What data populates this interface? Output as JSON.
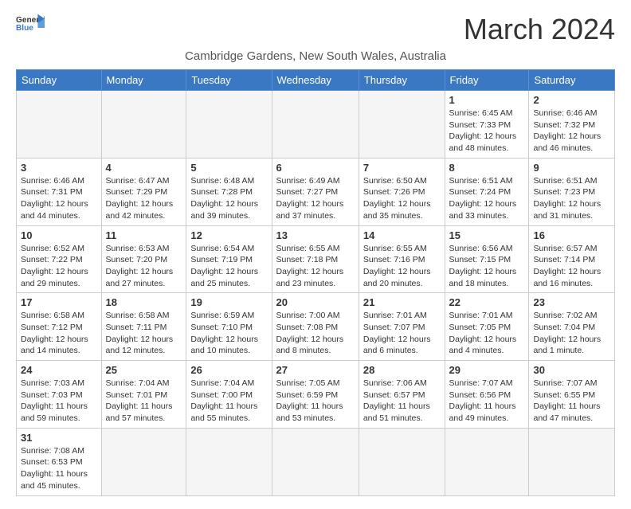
{
  "logo": {
    "general": "General",
    "blue": "Blue"
  },
  "title": "March 2024",
  "location": "Cambridge Gardens, New South Wales, Australia",
  "days_header": [
    "Sunday",
    "Monday",
    "Tuesday",
    "Wednesday",
    "Thursday",
    "Friday",
    "Saturday"
  ],
  "weeks": [
    [
      {
        "day": "",
        "info": ""
      },
      {
        "day": "",
        "info": ""
      },
      {
        "day": "",
        "info": ""
      },
      {
        "day": "",
        "info": ""
      },
      {
        "day": "",
        "info": ""
      },
      {
        "day": "1",
        "info": "Sunrise: 6:45 AM\nSunset: 7:33 PM\nDaylight: 12 hours and 48 minutes."
      },
      {
        "day": "2",
        "info": "Sunrise: 6:46 AM\nSunset: 7:32 PM\nDaylight: 12 hours and 46 minutes."
      }
    ],
    [
      {
        "day": "3",
        "info": "Sunrise: 6:46 AM\nSunset: 7:31 PM\nDaylight: 12 hours and 44 minutes."
      },
      {
        "day": "4",
        "info": "Sunrise: 6:47 AM\nSunset: 7:29 PM\nDaylight: 12 hours and 42 minutes."
      },
      {
        "day": "5",
        "info": "Sunrise: 6:48 AM\nSunset: 7:28 PM\nDaylight: 12 hours and 39 minutes."
      },
      {
        "day": "6",
        "info": "Sunrise: 6:49 AM\nSunset: 7:27 PM\nDaylight: 12 hours and 37 minutes."
      },
      {
        "day": "7",
        "info": "Sunrise: 6:50 AM\nSunset: 7:26 PM\nDaylight: 12 hours and 35 minutes."
      },
      {
        "day": "8",
        "info": "Sunrise: 6:51 AM\nSunset: 7:24 PM\nDaylight: 12 hours and 33 minutes."
      },
      {
        "day": "9",
        "info": "Sunrise: 6:51 AM\nSunset: 7:23 PM\nDaylight: 12 hours and 31 minutes."
      }
    ],
    [
      {
        "day": "10",
        "info": "Sunrise: 6:52 AM\nSunset: 7:22 PM\nDaylight: 12 hours and 29 minutes."
      },
      {
        "day": "11",
        "info": "Sunrise: 6:53 AM\nSunset: 7:20 PM\nDaylight: 12 hours and 27 minutes."
      },
      {
        "day": "12",
        "info": "Sunrise: 6:54 AM\nSunset: 7:19 PM\nDaylight: 12 hours and 25 minutes."
      },
      {
        "day": "13",
        "info": "Sunrise: 6:55 AM\nSunset: 7:18 PM\nDaylight: 12 hours and 23 minutes."
      },
      {
        "day": "14",
        "info": "Sunrise: 6:55 AM\nSunset: 7:16 PM\nDaylight: 12 hours and 20 minutes."
      },
      {
        "day": "15",
        "info": "Sunrise: 6:56 AM\nSunset: 7:15 PM\nDaylight: 12 hours and 18 minutes."
      },
      {
        "day": "16",
        "info": "Sunrise: 6:57 AM\nSunset: 7:14 PM\nDaylight: 12 hours and 16 minutes."
      }
    ],
    [
      {
        "day": "17",
        "info": "Sunrise: 6:58 AM\nSunset: 7:12 PM\nDaylight: 12 hours and 14 minutes."
      },
      {
        "day": "18",
        "info": "Sunrise: 6:58 AM\nSunset: 7:11 PM\nDaylight: 12 hours and 12 minutes."
      },
      {
        "day": "19",
        "info": "Sunrise: 6:59 AM\nSunset: 7:10 PM\nDaylight: 12 hours and 10 minutes."
      },
      {
        "day": "20",
        "info": "Sunrise: 7:00 AM\nSunset: 7:08 PM\nDaylight: 12 hours and 8 minutes."
      },
      {
        "day": "21",
        "info": "Sunrise: 7:01 AM\nSunset: 7:07 PM\nDaylight: 12 hours and 6 minutes."
      },
      {
        "day": "22",
        "info": "Sunrise: 7:01 AM\nSunset: 7:05 PM\nDaylight: 12 hours and 4 minutes."
      },
      {
        "day": "23",
        "info": "Sunrise: 7:02 AM\nSunset: 7:04 PM\nDaylight: 12 hours and 1 minute."
      }
    ],
    [
      {
        "day": "24",
        "info": "Sunrise: 7:03 AM\nSunset: 7:03 PM\nDaylight: 11 hours and 59 minutes."
      },
      {
        "day": "25",
        "info": "Sunrise: 7:04 AM\nSunset: 7:01 PM\nDaylight: 11 hours and 57 minutes."
      },
      {
        "day": "26",
        "info": "Sunrise: 7:04 AM\nSunset: 7:00 PM\nDaylight: 11 hours and 55 minutes."
      },
      {
        "day": "27",
        "info": "Sunrise: 7:05 AM\nSunset: 6:59 PM\nDaylight: 11 hours and 53 minutes."
      },
      {
        "day": "28",
        "info": "Sunrise: 7:06 AM\nSunset: 6:57 PM\nDaylight: 11 hours and 51 minutes."
      },
      {
        "day": "29",
        "info": "Sunrise: 7:07 AM\nSunset: 6:56 PM\nDaylight: 11 hours and 49 minutes."
      },
      {
        "day": "30",
        "info": "Sunrise: 7:07 AM\nSunset: 6:55 PM\nDaylight: 11 hours and 47 minutes."
      }
    ],
    [
      {
        "day": "31",
        "info": "Sunrise: 7:08 AM\nSunset: 6:53 PM\nDaylight: 11 hours and 45 minutes."
      },
      {
        "day": "",
        "info": ""
      },
      {
        "day": "",
        "info": ""
      },
      {
        "day": "",
        "info": ""
      },
      {
        "day": "",
        "info": ""
      },
      {
        "day": "",
        "info": ""
      },
      {
        "day": "",
        "info": ""
      }
    ]
  ]
}
